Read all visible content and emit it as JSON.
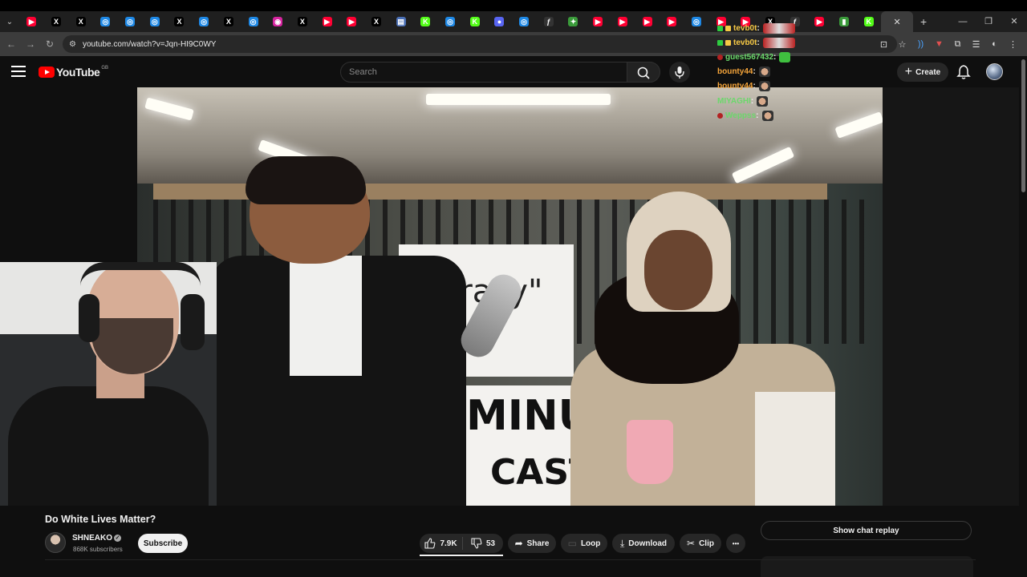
{
  "browser": {
    "url": "youtube.com/watch?v=Jqn-HI9C0WY",
    "tabs": [
      {
        "icon": "youtube-icon",
        "color": "#ff0033",
        "glyph": "▶"
      },
      {
        "icon": "x-icon",
        "color": "#000000",
        "glyph": "X"
      },
      {
        "icon": "x-icon",
        "color": "#000000",
        "glyph": "X"
      },
      {
        "icon": "messenger-icon",
        "color": "#1e88e5",
        "glyph": "◎"
      },
      {
        "icon": "messenger-icon",
        "color": "#1e88e5",
        "glyph": "◎"
      },
      {
        "icon": "messenger-icon",
        "color": "#1e88e5",
        "glyph": "◎"
      },
      {
        "icon": "x-icon",
        "color": "#000000",
        "glyph": "X"
      },
      {
        "icon": "messenger-icon",
        "color": "#1e88e5",
        "glyph": "◎"
      },
      {
        "icon": "x-icon",
        "color": "#000000",
        "glyph": "X"
      },
      {
        "icon": "messenger-icon",
        "color": "#1e88e5",
        "glyph": "◎"
      },
      {
        "icon": "instagram-icon",
        "color": "#d6249f",
        "glyph": "◉"
      },
      {
        "icon": "x-icon",
        "color": "#000000",
        "glyph": "X"
      },
      {
        "icon": "youtube-icon",
        "color": "#ff0033",
        "glyph": "▶"
      },
      {
        "icon": "youtube-icon",
        "color": "#ff0033",
        "glyph": "▶"
      },
      {
        "icon": "x-icon",
        "color": "#000000",
        "glyph": "X"
      },
      {
        "icon": "window-icon",
        "color": "#4a6fb5",
        "glyph": "▤"
      },
      {
        "icon": "kick-icon",
        "color": "#53fc18",
        "glyph": "K"
      },
      {
        "icon": "messenger-icon",
        "color": "#1e88e5",
        "glyph": "◎"
      },
      {
        "icon": "kick-icon",
        "color": "#53fc18",
        "glyph": "K"
      },
      {
        "icon": "discord-icon",
        "color": "#5865f2",
        "glyph": "●"
      },
      {
        "icon": "messenger-icon",
        "color": "#1e88e5",
        "glyph": "◎"
      },
      {
        "icon": "function-icon",
        "color": "#333333",
        "glyph": "ƒ"
      },
      {
        "icon": "pin-icon",
        "color": "#3a9a3a",
        "glyph": "✦"
      },
      {
        "icon": "youtube-icon",
        "color": "#ff0033",
        "glyph": "▶"
      },
      {
        "icon": "youtube-icon",
        "color": "#ff0033",
        "glyph": "▶"
      },
      {
        "icon": "youtube-icon",
        "color": "#ff0033",
        "glyph": "▶"
      },
      {
        "icon": "youtube-icon",
        "color": "#ff0033",
        "glyph": "▶"
      },
      {
        "icon": "messenger-icon",
        "color": "#1e88e5",
        "glyph": "◎"
      },
      {
        "icon": "youtube-icon",
        "color": "#ff0033",
        "glyph": "▶"
      },
      {
        "icon": "youtube-icon",
        "color": "#ff0033",
        "glyph": "▶"
      },
      {
        "icon": "x-icon",
        "color": "#000000",
        "glyph": "X"
      },
      {
        "icon": "function-icon",
        "color": "#333333",
        "glyph": "ƒ"
      },
      {
        "icon": "youtube-icon",
        "color": "#ff0033",
        "glyph": "▶"
      },
      {
        "icon": "chart-icon",
        "color": "#3a9a3a",
        "glyph": "▮"
      },
      {
        "icon": "kick-icon",
        "color": "#53fc18",
        "glyph": "K"
      }
    ]
  },
  "youtube": {
    "logo_text": "YouTube",
    "country_code": "GB",
    "search_placeholder": "Search",
    "create_label": "Create"
  },
  "chat_overlay": [
    {
      "user": "tevb0t",
      "name_color": "#f6c945",
      "badge_color": "#2ecc40",
      "emote": "wide"
    },
    {
      "user": "tevb0t",
      "name_color": "#f6c945",
      "badge_color": "#2ecc40",
      "emote": "wide"
    },
    {
      "user": "guest567432",
      "name_color": "#6bd86b",
      "badge_color": "#b22222",
      "emote": "green"
    },
    {
      "user": "bounty44",
      "name_color": "#f6a53a",
      "badge_color": "",
      "emote": "face"
    },
    {
      "user": "bounty44",
      "name_color": "#f6a53a",
      "badge_color": "",
      "emote": "face"
    },
    {
      "user": "MIYAGHI",
      "name_color": "#6bd86b",
      "badge_color": "",
      "emote": "face"
    },
    {
      "user": "Weppss",
      "name_color": "#6bd86b",
      "badge_color": "#b22222",
      "emote": "face"
    }
  ],
  "video": {
    "sign_top": "\"Crazy\"",
    "sign_bottom_1": "MINU",
    "sign_bottom_2": "CAST",
    "title": "Do White Lives Matter?",
    "channel": "SHNEAKO",
    "subscribers": "868K subscribers",
    "subscribe_label": "Subscribe",
    "likes": "7.9K",
    "dislikes": "53",
    "share_label": "Share",
    "loop_label": "Loop",
    "download_label": "Download",
    "clip_label": "Clip",
    "more_label": "•••",
    "chat_replay_label": "Show chat replay"
  }
}
